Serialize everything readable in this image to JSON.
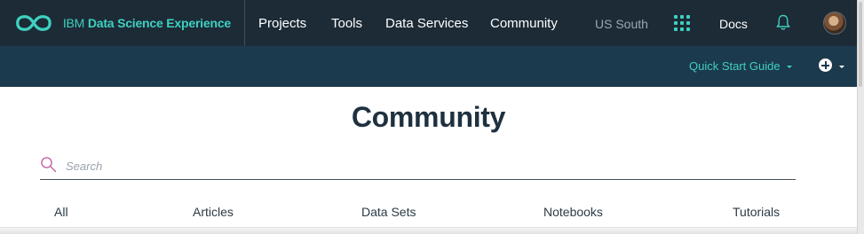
{
  "header": {
    "brand_ibm": "IBM",
    "brand_product": "Data Science Experience",
    "nav": [
      {
        "label": "Projects"
      },
      {
        "label": "Tools"
      },
      {
        "label": "Data Services"
      },
      {
        "label": "Community"
      }
    ],
    "region": "US South",
    "docs_label": "Docs",
    "icons": {
      "logo": "infinity-logo-icon",
      "apps": "app-grid-icon",
      "notifications": "bell-icon",
      "avatar": "user-avatar"
    },
    "colors": {
      "bar": "#1c2b36",
      "accent": "#3fd0c0"
    }
  },
  "subbar": {
    "quick_start_label": "Quick Start Guide",
    "add_icon": "plus-circle-icon",
    "background": "#1c3a4d"
  },
  "main": {
    "title": "Community",
    "search": {
      "placeholder": "Search",
      "value": ""
    },
    "filters": [
      {
        "label": "All"
      },
      {
        "label": "Articles"
      },
      {
        "label": "Data Sets"
      },
      {
        "label": "Notebooks"
      },
      {
        "label": "Tutorials"
      }
    ]
  }
}
